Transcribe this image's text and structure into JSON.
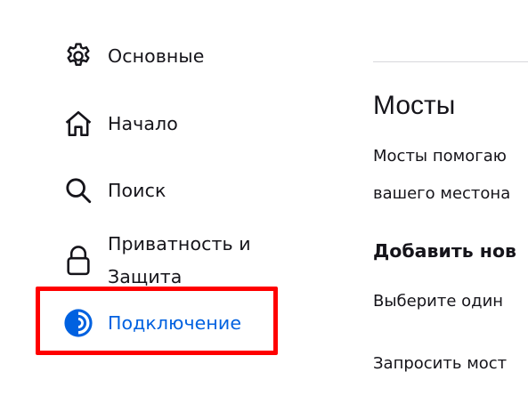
{
  "sidebar": {
    "items": [
      {
        "label": "Основные",
        "icon": "gear-icon"
      },
      {
        "label": "Начало",
        "icon": "home-icon"
      },
      {
        "label": "Поиск",
        "icon": "search-icon"
      },
      {
        "label": "Приватность и Защита",
        "icon": "lock-icon"
      },
      {
        "label": "Подключение",
        "icon": "tor-onion-icon",
        "selected": true
      }
    ]
  },
  "main": {
    "section_title": "Мосты",
    "description_lines": [
      "Мосты помогаю",
      "вашего местона"
    ],
    "subheading": "Добавить нов",
    "options": [
      "Выберите один",
      "Запросить мост"
    ]
  },
  "colors": {
    "accent": "#0061e0",
    "highlight": "#ff0000",
    "text": "#15141a"
  }
}
